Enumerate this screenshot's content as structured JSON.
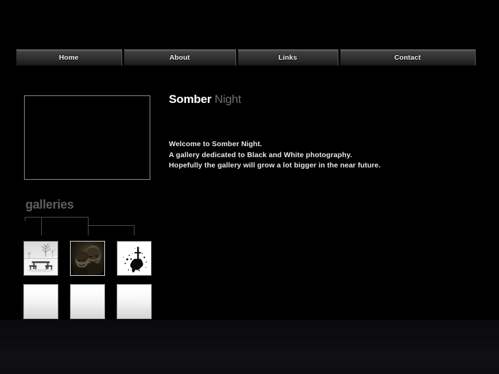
{
  "site": {
    "title_strong": "Somber",
    "title_soft": "Night"
  },
  "nav": {
    "items": [
      {
        "label": "Home",
        "name": "nav-item-home"
      },
      {
        "label": "About",
        "name": "nav-item-about"
      },
      {
        "label": "Links",
        "name": "nav-item-links"
      },
      {
        "label": "Contact",
        "name": "nav-item-contact"
      }
    ]
  },
  "intro": {
    "lines": [
      "Welcome to Somber Night.",
      "A gallery dedicated to Black and White photography.",
      "Hopefully the gallery will grow a lot bigger in the near future."
    ]
  },
  "galleries": {
    "heading": "galleries",
    "thumbnails": [
      {
        "name": "thumbnail-snow-picnic-table",
        "kind": "photo",
        "selected": false
      },
      {
        "name": "thumbnail-portrait-pair",
        "kind": "photo",
        "selected": true
      },
      {
        "name": "thumbnail-ink-splatter",
        "kind": "photo",
        "selected": false
      },
      {
        "name": "thumbnail-placeholder-1",
        "kind": "placeholder",
        "selected": false
      },
      {
        "name": "thumbnail-placeholder-2",
        "kind": "placeholder",
        "selected": false
      },
      {
        "name": "thumbnail-placeholder-3",
        "kind": "placeholder",
        "selected": false
      }
    ]
  },
  "colors": {
    "page_background": "#000000",
    "nav_button_top": "#4a4a4a",
    "nav_button_bottom": "#1a1a1a",
    "nav_label": "#f2f2f2",
    "title_strong": "#ffffff",
    "title_soft": "#6e6e6e",
    "body_text": "#e8e8e8",
    "galleries_heading": "#5e5e64",
    "bracket_line": "#4c4c4c",
    "frame_border": "#8c8c8c",
    "footer": "#0d0d10"
  }
}
